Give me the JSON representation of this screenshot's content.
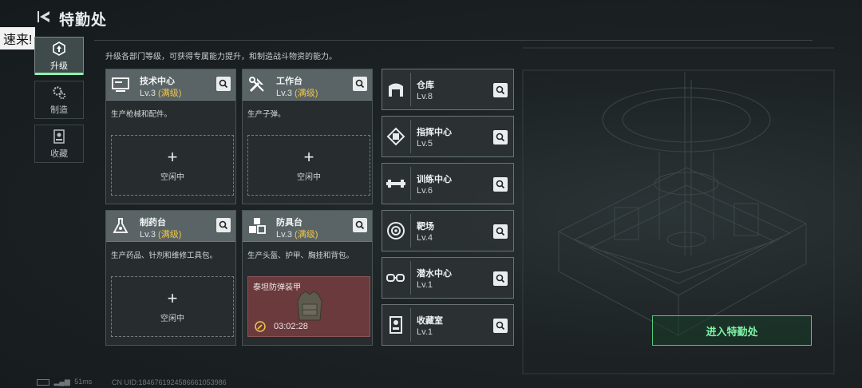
{
  "header": {
    "title": "特勤处",
    "overlay_text": "速来!"
  },
  "tabs": [
    {
      "label": "升级",
      "icon": "upgrade-icon",
      "active": true
    },
    {
      "label": "制造",
      "icon": "gears-icon",
      "active": false
    },
    {
      "label": "收藏",
      "icon": "showcase-icon",
      "active": false
    }
  ],
  "description": "升级各部门等级，可获得专属能力提升，和制造战斗物资的能力。",
  "cards": [
    {
      "name": "技术中心",
      "level": "Lv.3",
      "max": "(满级)",
      "desc": "生产枪械和配件。",
      "slot_label": "空闲中",
      "plus": "+"
    },
    {
      "name": "工作台",
      "level": "Lv.3",
      "max": "(满级)",
      "desc": "生产子弹。",
      "slot_label": "空闲中",
      "plus": "+"
    },
    {
      "name": "制药台",
      "level": "Lv.3",
      "max": "(满级)",
      "desc": "生产药品、针剂和维修工具包。",
      "slot_label": "空闲中",
      "plus": "+"
    },
    {
      "name": "防具台",
      "level": "Lv.3",
      "max": "(满级)",
      "desc": "生产头盔、护甲、胸挂和背包。",
      "craft_name": "泰坦防弹装甲",
      "craft_timer": "03:02:28"
    }
  ],
  "facilities": [
    {
      "name": "仓库",
      "level": "Lv.8",
      "icon": "warehouse-icon"
    },
    {
      "name": "指挥中心",
      "level": "Lv.5",
      "icon": "command-chip-icon"
    },
    {
      "name": "训练中心",
      "level": "Lv.6",
      "icon": "dumbbell-icon"
    },
    {
      "name": "靶场",
      "level": "Lv.4",
      "icon": "target-icon"
    },
    {
      "name": "潜水中心",
      "level": "Lv.1",
      "icon": "diving-mask-icon"
    },
    {
      "name": "收藏室",
      "level": "Lv.1",
      "icon": "display-case-icon"
    }
  ],
  "enter_button": "进入特勤处",
  "footer": {
    "ping": "51ms",
    "uid": "CN UID:1846761924586661053986"
  },
  "colors": {
    "accent_green": "#7ff4a6",
    "max_level": "#f0c54a",
    "craft_bg": "#6b3a3d"
  }
}
